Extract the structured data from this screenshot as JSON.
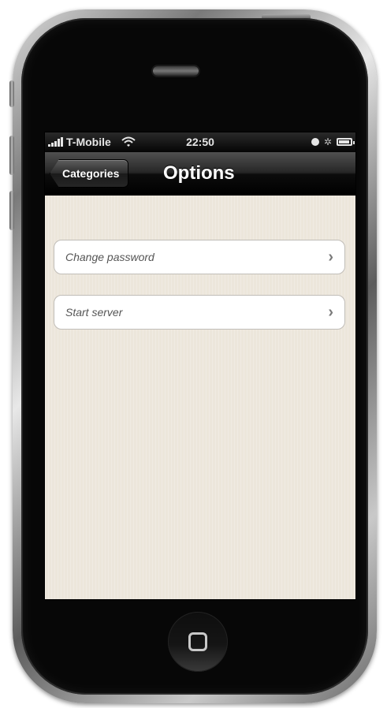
{
  "status_bar": {
    "carrier": "T-Mobile",
    "time": "22:50"
  },
  "nav_bar": {
    "back_label": "Categories",
    "title": "Options"
  },
  "options": [
    {
      "label": "Change password"
    },
    {
      "label": "Start server"
    }
  ],
  "icons": {
    "signal": "signal-bars-icon",
    "wifi": "wifi-icon",
    "alarm": "alarm-clock-icon",
    "bluetooth": "bluetooth-icon",
    "battery": "battery-charging-icon",
    "chevron": "chevron-right-icon",
    "home": "home-button-icon"
  },
  "colors": {
    "background_texture": "#ece6db",
    "navbar": "#1a1a1a",
    "row_background": "#ffffff"
  }
}
